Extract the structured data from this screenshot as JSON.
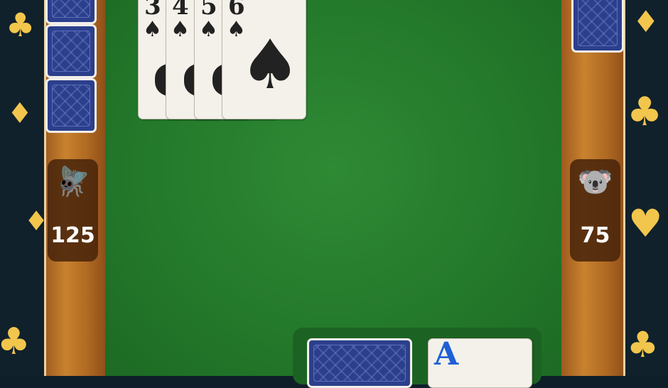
{
  "table": {
    "felt_color": "#247a2b",
    "rail_color": "#b06a22"
  },
  "top_hand": {
    "cards": [
      {
        "rank": "3",
        "suit": "♠"
      },
      {
        "rank": "4",
        "suit": "♠"
      },
      {
        "rank": "5",
        "suit": "♠"
      },
      {
        "rank": "6",
        "suit": "♠"
      }
    ]
  },
  "left_player": {
    "avatar_icon": "fly-icon",
    "avatar_glyph": "🪰",
    "score": "125"
  },
  "right_player": {
    "avatar_icon": "koala-icon",
    "avatar_glyph": "🐨",
    "score": "75"
  },
  "bottom_tray": {
    "face_card": {
      "rank": "A",
      "color": "#1f5fd6"
    }
  },
  "decor": {
    "suit_color": "#f2c64d"
  }
}
